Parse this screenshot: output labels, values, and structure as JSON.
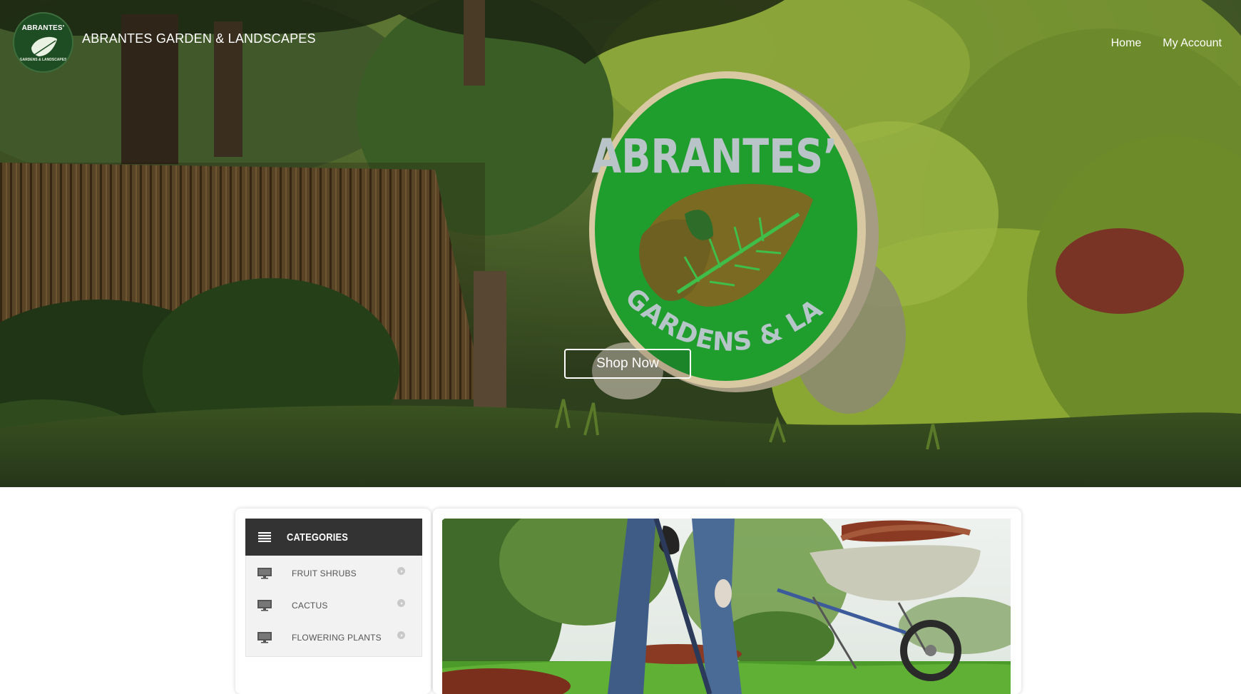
{
  "header": {
    "logo_text": "ABRANTES'",
    "logo_subtext": "GARDENS & LANDSCAPES",
    "brand_name": "ABRANTES GARDEN & LANDSCAPES",
    "nav": [
      {
        "label": "Home"
      },
      {
        "label": "My Account"
      }
    ]
  },
  "hero": {
    "sign_title": "ABRANTES’",
    "sign_subtitle": "GARDENS & LANDSCAPES",
    "cta_label": "Shop Now"
  },
  "categories": {
    "title": "CATEGORIES",
    "items": [
      {
        "label": "FRUIT SHRUBS",
        "icon": "monitor-icon"
      },
      {
        "label": "CACTUS",
        "icon": "monitor-icon"
      },
      {
        "label": "FLOWERING PLANTS",
        "icon": "monitor-icon"
      }
    ]
  },
  "colors": {
    "header_bar": "#333333",
    "category_bg": "#f2f2f2",
    "sign_green": "#1f9e2e"
  }
}
